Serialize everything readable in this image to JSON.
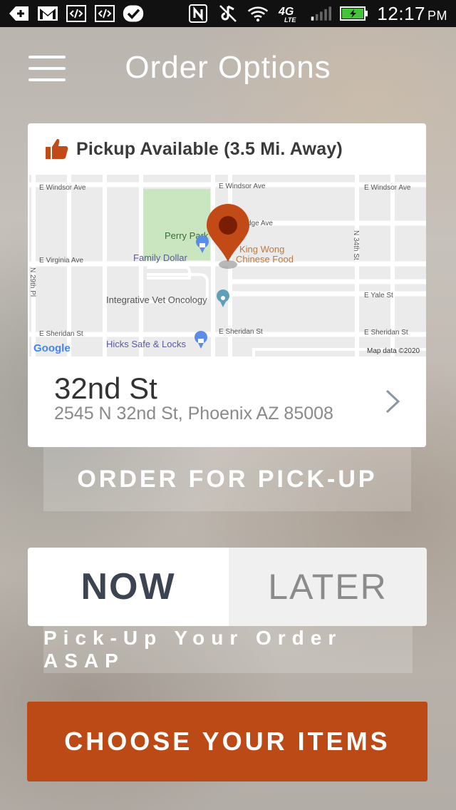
{
  "status_bar": {
    "time": "12:17",
    "ampm": "PM",
    "network": "4G LTE"
  },
  "header": {
    "title": "Order Options"
  },
  "pickup_card": {
    "availability": "Pickup Available (3.5 Mi. Away)",
    "location_name": "32nd St",
    "location_address": "2545 N 32nd St, Phoenix AZ 85008",
    "map": {
      "streets": [
        "E Windsor Ave",
        "E Windsor Ave",
        "E Windsor Ave",
        "dge Ave",
        "E Virginia Ave",
        "E Yale St",
        "E Sheridan St",
        "E Sheridan St",
        "E Sheridan St",
        "N 34th St",
        "N 29th Pl"
      ],
      "places": [
        "Perry Park",
        "Family Dollar",
        "Integrative Vet Oncology",
        "Hicks Safe & Locks",
        "King Wong",
        "Chinese Food"
      ],
      "logo": "Google",
      "attribution": "Map data ©2020"
    }
  },
  "order_button": {
    "label": "ORDER FOR PICK-UP"
  },
  "timing": {
    "now_label": "NOW",
    "later_label": "LATER",
    "selected": "NOW",
    "subtitle": "Pick-Up Your Order ASAP"
  },
  "choose_button": {
    "label": "CHOOSE YOUR ITEMS"
  },
  "colors": {
    "accent": "#bb4a17",
    "pin": "#c24a16",
    "map_bg": "#ebebeb",
    "park": "#c9e6c0"
  }
}
